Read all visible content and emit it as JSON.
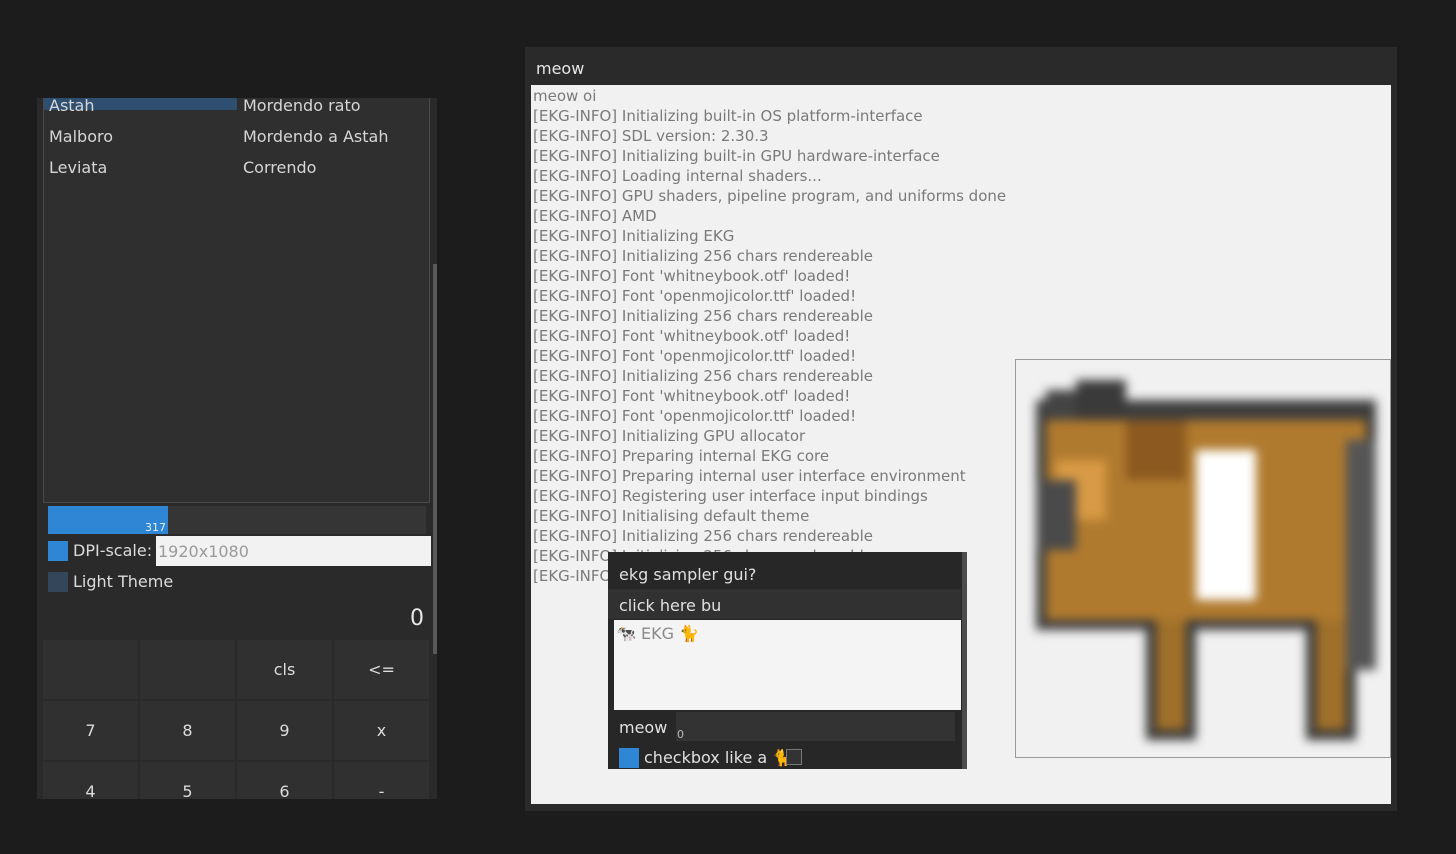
{
  "left_panel": {
    "table_rows": [
      {
        "col1": "Astah",
        "col2": "Mordendo rato"
      },
      {
        "col1": "Malboro",
        "col2": "Mordendo a Astah"
      },
      {
        "col1": "Leviata",
        "col2": "Correndo"
      }
    ],
    "progress": {
      "value_label": "317",
      "fraction": 0.317
    },
    "dpi": {
      "label": "DPI-scale:",
      "checked": true,
      "value": "1920x1080"
    },
    "light_theme": {
      "label": "Light Theme",
      "checked": false
    },
    "calculator": {
      "display": "0",
      "keys": [
        [
          "",
          "",
          "cls",
          "<="
        ],
        [
          "7",
          "8",
          "9",
          "x"
        ],
        [
          "4",
          "5",
          "6",
          "-"
        ]
      ]
    }
  },
  "meow_window": {
    "title": "meow",
    "log_lines": [
      "meow oi",
      "[EKG-INFO] Initializing built-in OS platform-interface",
      "[EKG-INFO] SDL version: 2.30.3",
      "[EKG-INFO] Initializing built-in GPU hardware-interface",
      "[EKG-INFO] Loading internal shaders...",
      "[EKG-INFO] GPU shaders, pipeline program, and uniforms done",
      "[EKG-INFO] AMD",
      "[EKG-INFO] Initializing EKG",
      "[EKG-INFO] Initializing 256 chars rendereable",
      "[EKG-INFO] Font 'whitneybook.otf' loaded!",
      "[EKG-INFO] Font 'openmojicolor.ttf' loaded!",
      "[EKG-INFO] Initializing 256 chars rendereable",
      "[EKG-INFO] Font 'whitneybook.otf' loaded!",
      "[EKG-INFO] Font 'openmojicolor.ttf' loaded!",
      "[EKG-INFO] Initializing 256 chars rendereable",
      "[EKG-INFO] Font 'whitneybook.otf' loaded!",
      "[EKG-INFO] Font 'openmojicolor.ttf' loaded!",
      "[EKG-INFO] Initializing GPU allocator",
      "[EKG-INFO] Preparing internal EKG core",
      "[EKG-INFO] Preparing internal user interface environment",
      "[EKG-INFO] Registering user interface input bindings",
      "[EKG-INFO] Initialising default theme",
      "[EKG-INFO] Initializing 256 chars rendereable",
      "[EKG-INFO] Initializing 256 chars rendereable",
      "[EKG-INFO]"
    ]
  },
  "sampler": {
    "title": "ekg sampler gui?",
    "button_label": "click here bu",
    "textbox_text": "🐄 EKG 🐈",
    "slider_label": "meow",
    "slider_value": "0",
    "checkbox_label": "checkbox like a 🐈",
    "checkbox_checked": true
  },
  "colors": {
    "accent": "#2e86d4",
    "panel": "#2a2a2a",
    "background": "#1c1c1c"
  }
}
